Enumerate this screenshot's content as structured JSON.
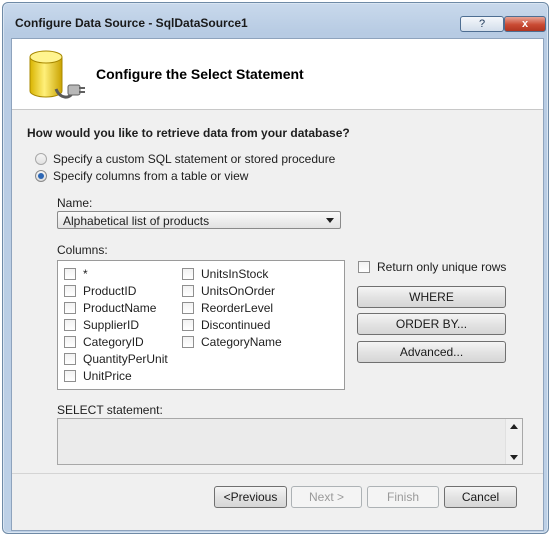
{
  "window": {
    "title": "Configure Data Source - SqlDataSource1",
    "help_glyph": "?",
    "close_glyph": "x"
  },
  "banner": {
    "title": "Configure the Select Statement",
    "icon": "database-plug-icon"
  },
  "question": "How would you like to retrieve data from your database?",
  "options": {
    "custom_sql": "Specify a custom SQL statement or stored procedure",
    "columns_from_table": "Specify columns from a table or view",
    "selected": "columns_from_table"
  },
  "name_label": "Name:",
  "name_value": "Alphabetical list of products",
  "columns_label": "Columns:",
  "columns_left": [
    "*",
    "ProductID",
    "ProductName",
    "SupplierID",
    "CategoryID",
    "QuantityPerUnit",
    "UnitPrice"
  ],
  "columns_right": [
    "UnitsInStock",
    "UnitsOnOrder",
    "ReorderLevel",
    "Discontinued",
    "CategoryName"
  ],
  "unique_rows_label": "Return only unique rows",
  "buttons": {
    "where": "WHERE",
    "order_by": "ORDER BY...",
    "advanced": "Advanced...",
    "previous": "<Previous",
    "next": "Next >",
    "finish": "Finish",
    "cancel": "Cancel"
  },
  "select_statement_label": "SELECT statement:",
  "select_statement_value": ""
}
